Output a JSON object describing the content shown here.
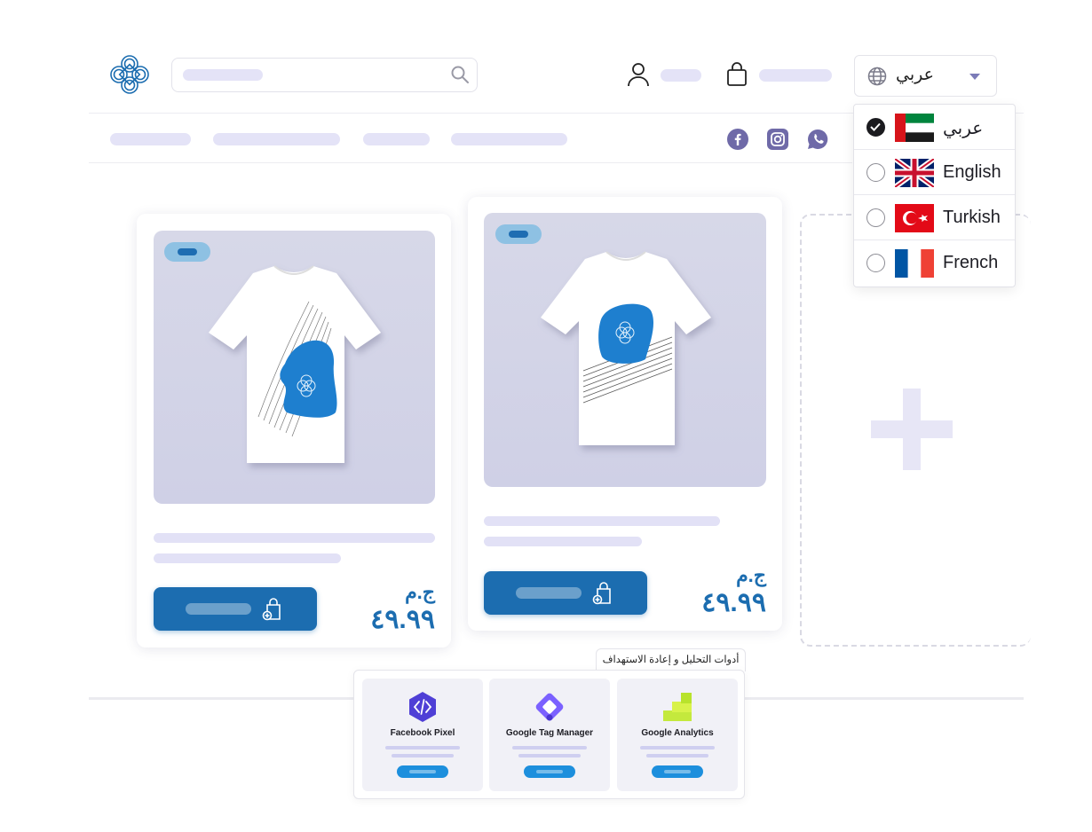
{
  "header": {
    "logo": "knot-logo-icon",
    "search": {
      "icon": "search-icon"
    },
    "account": {
      "icon": "user-icon"
    },
    "cart": {
      "icon": "shopping-bag-icon"
    },
    "language_select": {
      "icon": "globe-icon",
      "value": "عربي",
      "caret": "chevron-down-icon"
    }
  },
  "social": [
    "facebook-icon",
    "instagram-icon",
    "whatsapp-icon"
  ],
  "language_dropdown": {
    "items": [
      {
        "label": "عربي",
        "flag": "uae-flag",
        "checked": true
      },
      {
        "label": "English",
        "flag": "uk-flag",
        "checked": false
      },
      {
        "label": "Turkish",
        "flag": "turkey-flag",
        "checked": false
      },
      {
        "label": "French",
        "flag": "france-flag",
        "checked": false
      }
    ]
  },
  "products": [
    {
      "currency": "ج.م",
      "price": "٤٩.٩٩",
      "button_icon": "bag-plus-icon"
    },
    {
      "currency": "ج.م",
      "price": "٤٩.٩٩",
      "button_icon": "bag-plus-icon"
    }
  ],
  "add_product": {
    "icon": "plus-icon"
  },
  "tools": {
    "title": "أدوات التحليل و إعادة الاستهداف",
    "items": [
      {
        "name": "Facebook Pixel",
        "icon": "facebook-pixel-icon"
      },
      {
        "name": "Google Tag Manager",
        "icon": "google-tag-manager-icon"
      },
      {
        "name": "Google Analytics",
        "icon": "google-analytics-icon"
      }
    ]
  },
  "colors": {
    "primary": "#1c6db0",
    "placeholder": "#e4e3f7",
    "social": "#6f6aa8",
    "tool_button": "#1d8fdd"
  }
}
